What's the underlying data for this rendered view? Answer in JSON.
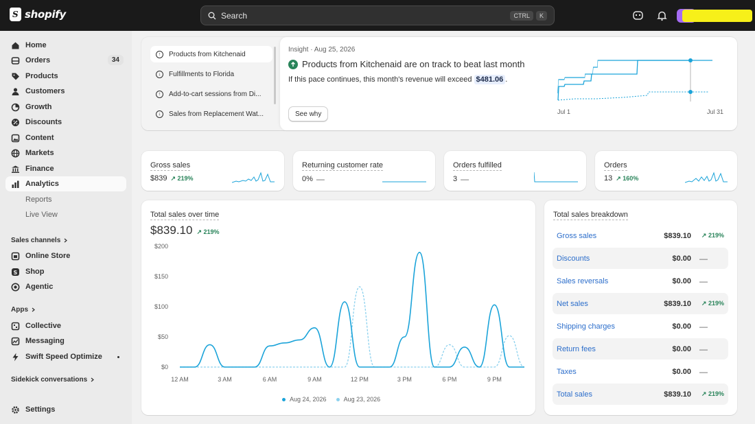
{
  "brand": {
    "name": "shopify"
  },
  "search": {
    "placeholder": "Search",
    "shortcut_ctrl": "CTRL",
    "shortcut_key": "K"
  },
  "sidebar": {
    "items": [
      {
        "label": "Home",
        "icon": "home-icon"
      },
      {
        "label": "Orders",
        "icon": "orders-icon",
        "badge": "34"
      },
      {
        "label": "Products",
        "icon": "tag-icon"
      },
      {
        "label": "Customers",
        "icon": "person-icon"
      },
      {
        "label": "Growth",
        "icon": "growth-icon"
      },
      {
        "label": "Discounts",
        "icon": "discount-icon"
      },
      {
        "label": "Content",
        "icon": "content-icon"
      },
      {
        "label": "Markets",
        "icon": "globe-icon"
      },
      {
        "label": "Finance",
        "icon": "bank-icon"
      },
      {
        "label": "Analytics",
        "icon": "chart-icon",
        "active": true
      },
      {
        "label": "Reports"
      },
      {
        "label": "Live View"
      }
    ],
    "sales_channels_heading": "Sales channels",
    "sales_channels": [
      {
        "label": "Online Store",
        "icon": "store-icon"
      },
      {
        "label": "Shop",
        "icon": "shop-icon"
      },
      {
        "label": "Agentic",
        "icon": "agentic-icon"
      }
    ],
    "apps_heading": "Apps",
    "apps": [
      {
        "label": "Collective",
        "icon": "collective-icon"
      },
      {
        "label": "Messaging",
        "icon": "messaging-icon"
      },
      {
        "label": "Swift Speed Optimize",
        "icon": "swift-icon"
      }
    ],
    "sidekick_heading": "Sidekick conversations",
    "settings": "Settings"
  },
  "insights": {
    "list": [
      {
        "label": "Products from Kitchenaid",
        "direction": "up"
      },
      {
        "label": "Fulfillments to Florida",
        "direction": "down"
      },
      {
        "label": "Add-to-cart sessions from Di...",
        "direction": "up"
      },
      {
        "label": "Sales from Replacement Wat...",
        "direction": "down"
      }
    ],
    "meta": "Insight · Aug 25, 2026",
    "title": "Products from Kitchenaid are on track to beat last month",
    "text_before": "If this pace continues, this month's revenue will exceed",
    "amount": "$481.06",
    "text_after": ".",
    "button": "See why",
    "axis_start": "Jul 1",
    "axis_end": "Jul 31"
  },
  "metrics": [
    {
      "title": "Gross sales",
      "value": "$839",
      "trend": "219%"
    },
    {
      "title": "Returning customer rate",
      "value": "0%",
      "trend": "—"
    },
    {
      "title": "Orders fulfilled",
      "value": "3",
      "trend": "—"
    },
    {
      "title": "Orders",
      "value": "13",
      "trend": "160%"
    }
  ],
  "sales_chart": {
    "title": "Total sales over time",
    "total": "$839.10",
    "trend": "219%",
    "legend": [
      {
        "name": "Aug 24, 2026",
        "color": "#1aa3d9"
      },
      {
        "name": "Aug 23, 2026",
        "color": "#8cd1ee"
      }
    ]
  },
  "chart_data": {
    "type": "line",
    "x": [
      "12 AM",
      "1 AM",
      "2 AM",
      "3 AM",
      "4 AM",
      "5 AM",
      "6 AM",
      "7 AM",
      "8 AM",
      "9 AM",
      "10 AM",
      "11 AM",
      "12 PM",
      "1 PM",
      "2 PM",
      "3 PM",
      "4 PM",
      "5 PM",
      "6 PM",
      "7 PM",
      "8 PM",
      "9 PM",
      "10 PM",
      "11 PM"
    ],
    "xticks": [
      "12 AM",
      "3 AM",
      "6 AM",
      "9 AM",
      "12 PM",
      "3 PM",
      "6 PM",
      "9 PM"
    ],
    "yticks": [
      "$0",
      "$50",
      "$100",
      "$150",
      "$200"
    ],
    "ylim": [
      0,
      200
    ],
    "series": [
      {
        "name": "Aug 24, 2026",
        "values": [
          0,
          0,
          37,
          0,
          0,
          0,
          35,
          40,
          45,
          65,
          0,
          108,
          0,
          0,
          0,
          50,
          190,
          0,
          0,
          33,
          0,
          103,
          0,
          0
        ]
      },
      {
        "name": "Aug 23, 2026",
        "values": [
          0,
          0,
          0,
          0,
          0,
          0,
          0,
          0,
          0,
          0,
          0,
          0,
          133,
          0,
          0,
          0,
          0,
          0,
          37,
          0,
          0,
          0,
          52,
          0
        ]
      }
    ]
  },
  "breakdown": {
    "title": "Total sales breakdown",
    "rows": [
      {
        "label": "Gross sales",
        "value": "$839.10",
        "trend": "219%"
      },
      {
        "label": "Discounts",
        "value": "$0.00",
        "trend": "—"
      },
      {
        "label": "Sales reversals",
        "value": "$0.00",
        "trend": "—"
      },
      {
        "label": "Net sales",
        "value": "$839.10",
        "trend": "219%"
      },
      {
        "label": "Shipping charges",
        "value": "$0.00",
        "trend": "—"
      },
      {
        "label": "Return fees",
        "value": "$0.00",
        "trend": "—"
      },
      {
        "label": "Taxes",
        "value": "$0.00",
        "trend": "—"
      },
      {
        "label": "Total sales",
        "value": "$839.10",
        "trend": "219%"
      }
    ]
  }
}
